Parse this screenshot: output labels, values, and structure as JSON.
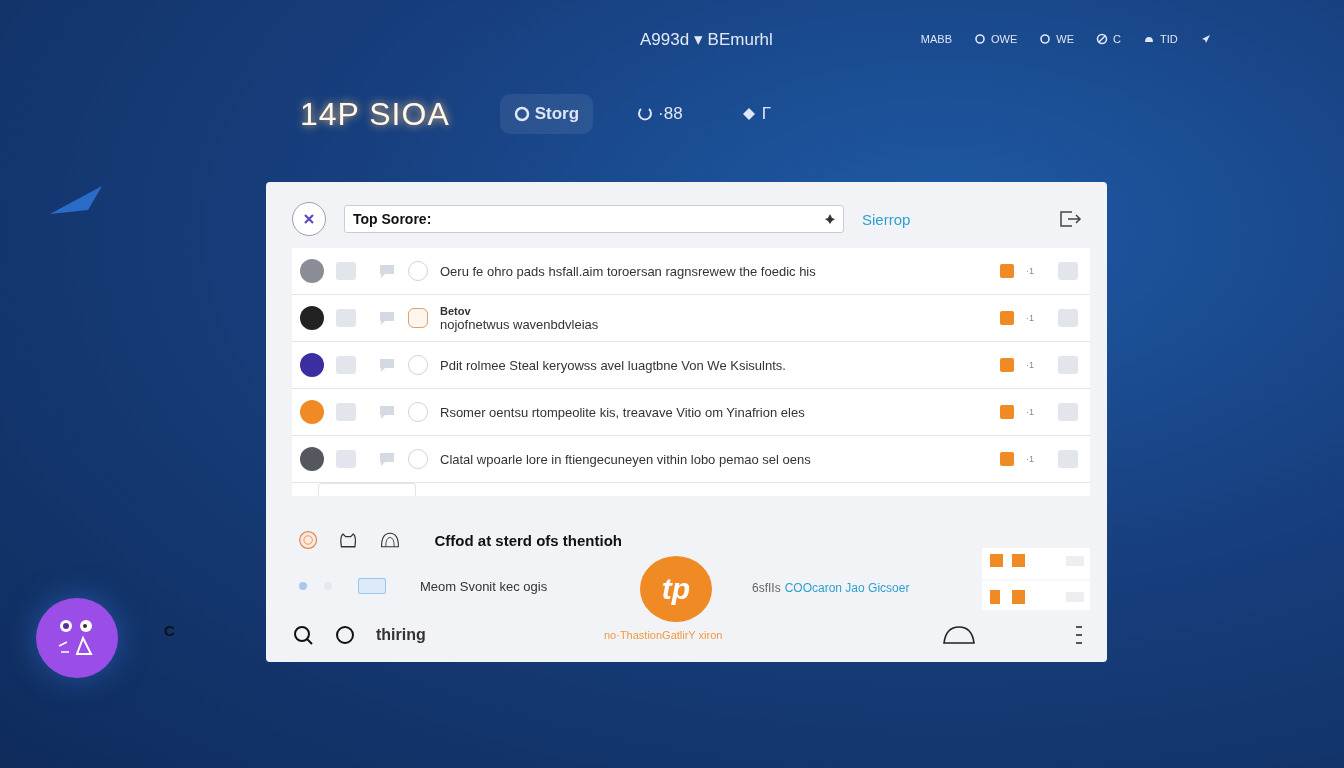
{
  "top_bar": {
    "title": "A993d ▾ BEmurhl",
    "items": [
      {
        "label": "MABB"
      },
      {
        "label": "OWE"
      },
      {
        "label": "WE"
      },
      {
        "label": "C"
      },
      {
        "label": "TID"
      }
    ]
  },
  "header": {
    "logo": "14P SIOA",
    "tabs": [
      {
        "label": "Storg",
        "selected": true
      },
      {
        "label": "·88",
        "selected": false
      },
      {
        "label": "Γ",
        "selected": false
      }
    ]
  },
  "search": {
    "value": "Top Sorore:",
    "link": "Sierrop"
  },
  "rows": [
    {
      "lines": [
        "Oeru fe ohro pads hsfall.aim toroersan ragnsrewew the foedic his"
      ],
      "color": "#8a8d96",
      "selected": false,
      "count": "·1"
    },
    {
      "lines": [
        "Betov",
        "nojofnetwus wavenbdvleias"
      ],
      "color": "#222222",
      "selected": true,
      "count": "·1"
    },
    {
      "lines": [
        "Pdit rolmee Steal keryowss avel luagtbne Von We Ksisulnts."
      ],
      "color": "#3a2ea0",
      "selected": false,
      "count": "·1"
    },
    {
      "lines": [
        "Rsomer oentsu rtompeolite kis, treavave Vitio om Yinafrion eles"
      ],
      "color": "#f08a24",
      "selected": false,
      "count": "·1"
    },
    {
      "lines": [
        "Clatal wpoarle lore in ftiengecuneyen vithin lobo pemao sel oens"
      ],
      "color": "#55575e",
      "selected": false,
      "count": "·1"
    }
  ],
  "summary": {
    "heading": "Cffod at  sterd ofs thentioh",
    "note": "Meom Svonit kec ogis",
    "badge": "tp",
    "prefix": "6sfIIs",
    "link": "COOcaron Jao Gicsoer"
  },
  "footer": {
    "label": "thiring",
    "caption": "no·ThastionGatlirY xiron"
  },
  "side_glyph": "C"
}
